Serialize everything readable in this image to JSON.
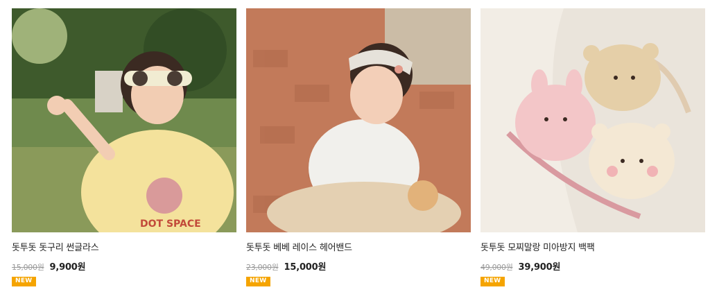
{
  "products": [
    {
      "name": "돗투돗 돗구리 썬글라스",
      "original_price": "15,000원",
      "sale_price": "9,900원",
      "badge": "NEW",
      "image_alt": "sunglasses-product-photo"
    },
    {
      "name": "돗투돗 베베 레이스 헤어밴드",
      "original_price": "23,000원",
      "sale_price": "15,000원",
      "badge": "NEW",
      "image_alt": "lace-hairband-product-photo"
    },
    {
      "name": "돗투돗 모찌말랑 미아방지 백팩",
      "original_price": "49,000원",
      "sale_price": "39,900원",
      "badge": "NEW",
      "image_alt": "anti-lost-backpack-product-photo"
    }
  ],
  "colors": {
    "badge": "#f5a400",
    "original_price": "#999999",
    "text": "#222222"
  }
}
